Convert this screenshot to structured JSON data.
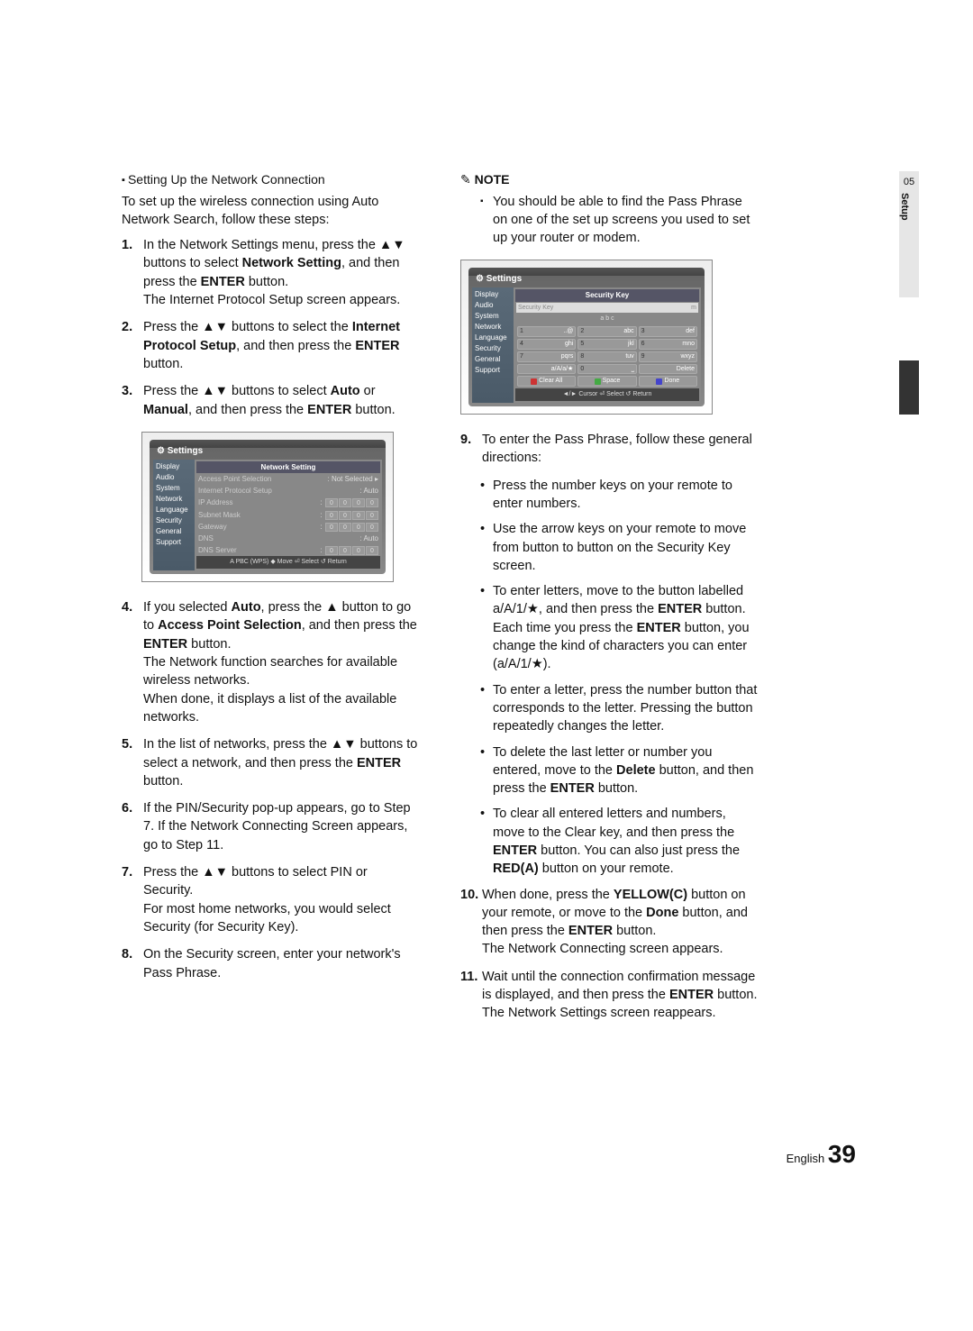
{
  "side": {
    "chapter": "05",
    "title": "Setup"
  },
  "footer": {
    "lang": "English",
    "page": "39"
  },
  "left": {
    "subhead": "Setting Up the Network Connection",
    "intro": "To set up the wireless connection using Auto Network Search, follow these steps:",
    "steps_a": [
      {
        "n": "1.",
        "html": "In the Network Settings menu, press the ▲▼ buttons to select <b>Network Setting</b>, and then press the <b>ENTER</b> button.<br>The Internet Protocol Setup screen appears."
      },
      {
        "n": "2.",
        "html": "Press the ▲▼ buttons to select the <b>Internet Protocol Setup</b>, and then press the <b>ENTER</b> button."
      },
      {
        "n": "3.",
        "html": "Press the ▲▼ buttons to select <b>Auto</b> or <b>Manual</b>, and then press the <b>ENTER</b> button."
      }
    ],
    "steps_b": [
      {
        "n": "4.",
        "html": "If you selected <b>Auto</b>, press the ▲ button to go to <b>Access Point Selection</b>, and then press the <b>ENTER</b> button.<br>The Network function searches for available wireless networks.<br>When done, it displays a list of the available networks."
      },
      {
        "n": "5.",
        "html": "In the list of networks, press the ▲▼ buttons to select a network, and then press the <b>ENTER</b> button."
      },
      {
        "n": "6.",
        "html": "If the PIN/Security pop-up appears, go to Step 7. If the Network Connecting Screen appears, go to Step 11."
      },
      {
        "n": "7.",
        "html": "Press the ▲▼ buttons to select PIN or Security.<br>For most home networks, you would select Security (for Security Key)."
      },
      {
        "n": "8.",
        "html": "On the Security screen, enter your network's Pass Phrase."
      }
    ]
  },
  "dev1": {
    "title": "Settings",
    "side": [
      "Display",
      "Audio",
      "System",
      "Network",
      "Language",
      "Security",
      "General",
      "Support"
    ],
    "panel": "Network Setting",
    "rows": [
      {
        "l": "Access Point Selection",
        "v": ": Not Selected",
        "arrow": "▸"
      },
      {
        "l": "Internet Protocol Setup",
        "v": ": Auto"
      },
      {
        "l": "IP Address",
        "ip": [
          "0",
          "0",
          "0",
          "0"
        ]
      },
      {
        "l": "Subnet Mask",
        "ip": [
          "0",
          "0",
          "0",
          "0"
        ]
      },
      {
        "l": "Gateway",
        "ip": [
          "0",
          "0",
          "0",
          "0"
        ]
      },
      {
        "l": "DNS",
        "v": ": Auto"
      },
      {
        "l": "DNS Server",
        "ip": [
          "0",
          "0",
          "0",
          "0"
        ]
      }
    ],
    "foot": "A PBC (WPS)   ◆ Move   ⏎ Select   ↺ Return"
  },
  "right": {
    "notehead": "NOTE",
    "note": "You should be able to find the Pass Phrase on one of the set up screens you used to set up your router or modem.",
    "step9": {
      "n": "9.",
      "html": "To enter the Pass Phrase, follow these general directions:"
    },
    "bullets": [
      "Press the number keys on your remote to enter numbers.",
      "Use the arrow keys on your remote to move from button to button on the Security Key screen.",
      "To enter letters, move to the button labelled a/A/1/★, and then press the <b>ENTER</b> button. Each time you press the <b>ENTER</b> button, you change the kind of characters you can enter (a/A/1/★).",
      "To enter a letter, press the number button that corresponds to the letter. Pressing the button repeatedly changes the letter.",
      "To delete the last letter or number you entered, move to the <b>Delete</b> button, and then press the <b>ENTER</b> button.",
      "To clear all entered letters and numbers, move to the Clear key, and then press the <b>ENTER</b> button. You can also just press the <b>RED(A)</b> button on your remote."
    ],
    "steps_c": [
      {
        "n": "10.",
        "html": "When done, press the <b>YELLOW(C)</b> button on your remote, or move to the <b>Done</b> button, and then press the <b>ENTER</b> button.<br>The Network Connecting screen appears."
      },
      {
        "n": "11.",
        "html": "Wait until the connection confirmation message is displayed, and then press the <b>ENTER</b> button. The Network Settings screen reappears."
      }
    ]
  },
  "dev2": {
    "title": "Settings",
    "side": [
      "Display",
      "Audio",
      "System",
      "Network",
      "Language",
      "Security",
      "General",
      "Support"
    ],
    "panel": "Security Key",
    "input_ph": "Security Key",
    "input_icon": "m",
    "abc": "a  b  c",
    "keys": [
      [
        "1",
        "..@"
      ],
      [
        "2",
        "abc"
      ],
      [
        "3",
        "def"
      ],
      [
        "4",
        "ghi"
      ],
      [
        "5",
        "jkl"
      ],
      [
        "6",
        "mno"
      ],
      [
        "7",
        "pqrs"
      ],
      [
        "8",
        "tuv"
      ],
      [
        "9",
        "wxyz"
      ],
      [
        "",
        "a/A/a/★"
      ],
      [
        "0",
        "⎵"
      ],
      [
        "",
        "Delete"
      ]
    ],
    "btns": [
      [
        "red",
        "Clear All"
      ],
      [
        "grn",
        "Space"
      ],
      [
        "blu",
        "Done"
      ]
    ],
    "foot": "◄/► Cursor   ⏎ Select   ↺ Return"
  }
}
